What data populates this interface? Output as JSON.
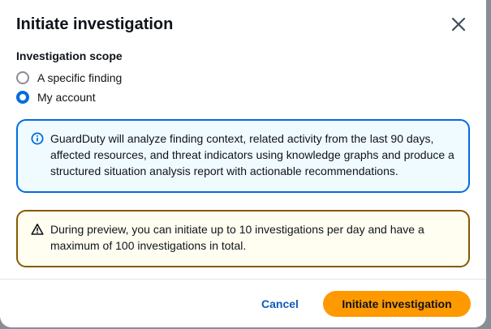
{
  "modal": {
    "title": "Initiate investigation"
  },
  "scope": {
    "label": "Investigation scope",
    "options": [
      {
        "label": "A specific finding",
        "selected": false
      },
      {
        "label": "My account",
        "selected": true
      }
    ]
  },
  "alerts": {
    "info": {
      "icon": "info-icon",
      "text": "GuardDuty will analyze finding context, related activity from the last 90 days, affected resources, and threat indicators using knowledge graphs and produce a structured situation analysis report with actionable recommendations."
    },
    "warning": {
      "icon": "warning-icon",
      "text": "During preview, you can initiate up to 10 investigations per day and have a maximum of 100 investigations in total."
    }
  },
  "footer": {
    "cancel_label": "Cancel",
    "primary_label": "Initiate investigation"
  },
  "colors": {
    "primary": "#ff9900",
    "link": "#0f5bbd",
    "info_border": "#006ce0",
    "warning_border": "#855900"
  }
}
